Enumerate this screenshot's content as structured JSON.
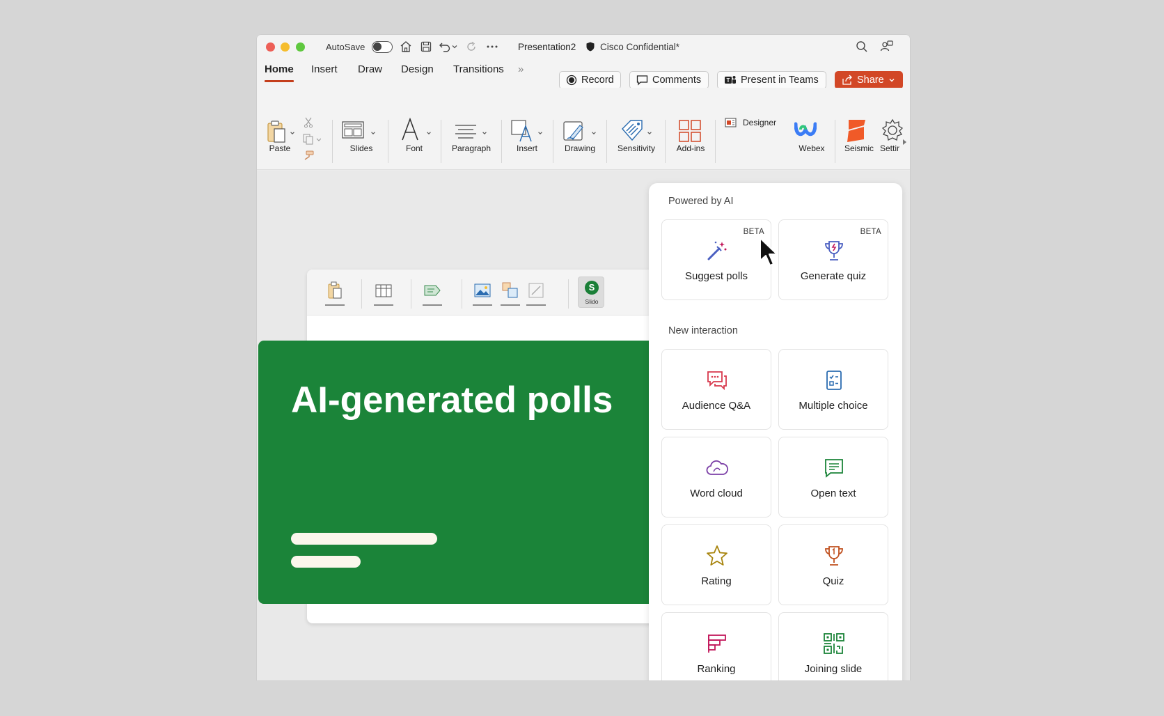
{
  "window": {
    "autosave_label": "AutoSave",
    "doc_title": "Presentation2",
    "confidential": "Cisco Confidential*"
  },
  "tabs": [
    {
      "label": "Home",
      "active": true
    },
    {
      "label": "Insert",
      "active": false
    },
    {
      "label": "Draw",
      "active": false
    },
    {
      "label": "Design",
      "active": false
    },
    {
      "label": "Transitions",
      "active": false
    }
  ],
  "tabs_more": "»",
  "actions": {
    "record": "Record",
    "comments": "Comments",
    "present": "Present in Teams",
    "share": "Share"
  },
  "ribbon": {
    "paste": "Paste",
    "slides": "Slides",
    "font": "Font",
    "paragraph": "Paragraph",
    "insert": "Insert",
    "drawing": "Drawing",
    "sensitivity": "Sensitivity",
    "addins": "Add-ins",
    "designer": "Designer",
    "webex": "Webex",
    "seismic": "Seismic",
    "settings": "Settir"
  },
  "slide": {
    "title": "AI-generated polls",
    "slido_label": "Slido",
    "slido_letter": "S"
  },
  "panel": {
    "ai_section": "Powered by AI",
    "new_section": "New interaction",
    "beta": "BETA",
    "ai_cards": [
      {
        "label": "Suggest polls",
        "icon": "magic-wand-icon"
      },
      {
        "label": "Generate quiz",
        "icon": "trophy-sparkle-icon"
      }
    ],
    "cards": [
      {
        "label": "Audience Q&A",
        "icon": "chat-bubbles-icon"
      },
      {
        "label": "Multiple choice",
        "icon": "checklist-icon"
      },
      {
        "label": "Word cloud",
        "icon": "cloud-icon"
      },
      {
        "label": "Open text",
        "icon": "text-bubble-icon"
      },
      {
        "label": "Rating",
        "icon": "star-icon"
      },
      {
        "label": "Quiz",
        "icon": "trophy-icon"
      },
      {
        "label": "Ranking",
        "icon": "ranking-icon"
      },
      {
        "label": "Joining slide",
        "icon": "qr-code-icon"
      }
    ]
  },
  "colors": {
    "accent": "#c43e1c",
    "share": "#d24726",
    "slide_green": "#1b8439",
    "slido_green": "#1a7f37"
  }
}
